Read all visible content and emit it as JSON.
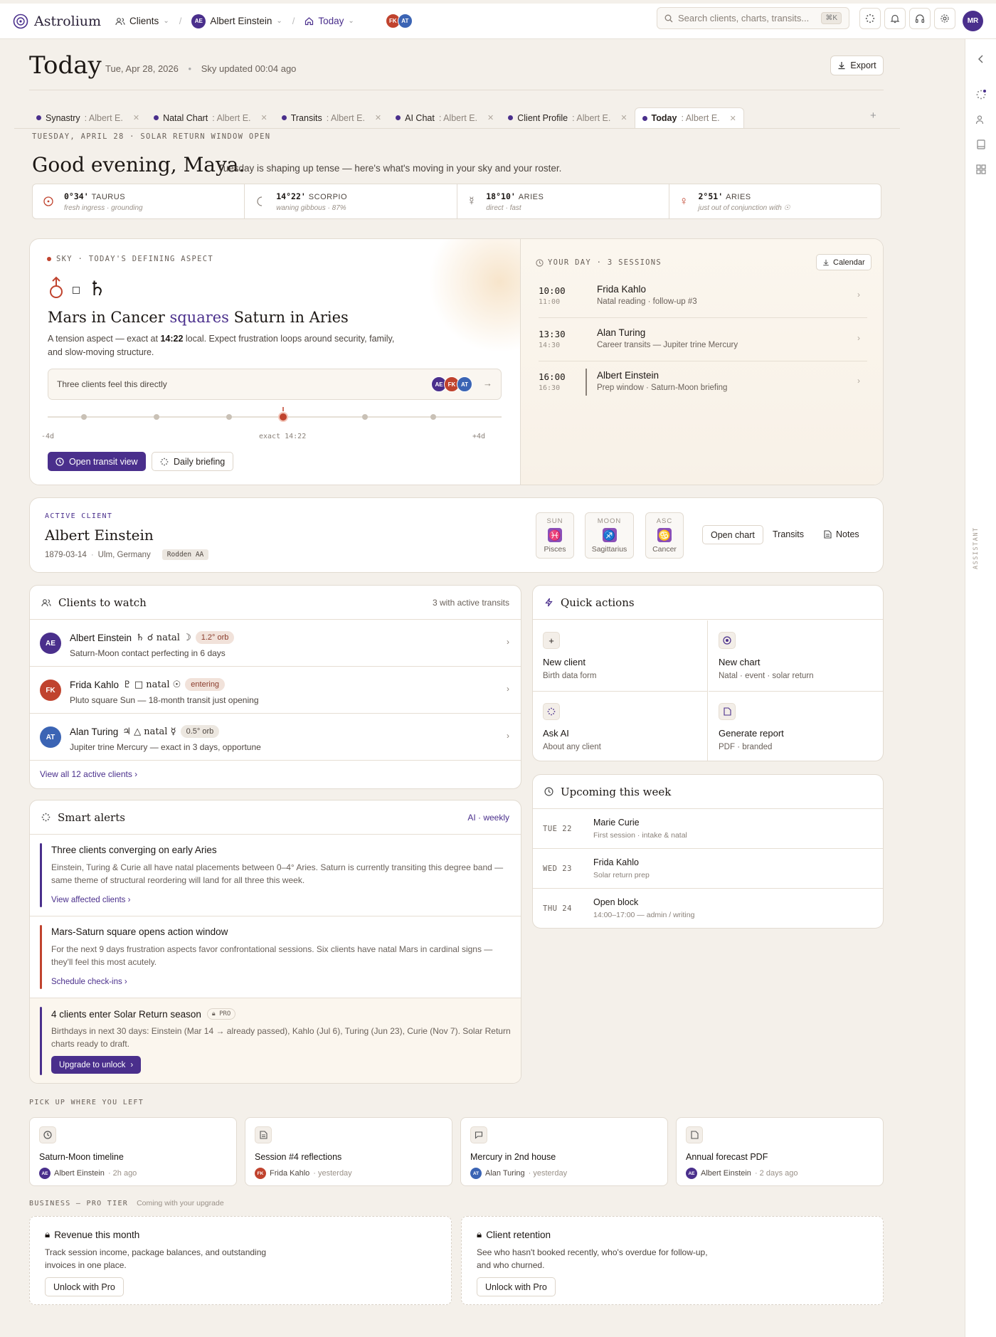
{
  "app": {
    "name": "Astrolium",
    "user_initials": "MR"
  },
  "nav": {
    "clients": "Clients",
    "client": "Albert Einstein",
    "client_initials": "AE",
    "today": "Today",
    "avatars": [
      "FK",
      "AT"
    ]
  },
  "search": {
    "placeholder": "Search clients, charts, transits...",
    "shortcut": "⌘K"
  },
  "colors": {
    "accent": "#4a2f8c",
    "ae": "#4a2f8c",
    "fk": "#c0432e",
    "at": "#3b64b4",
    "ae_bar": "#4a2f8c",
    "alert_red": "#c0432e"
  },
  "header": {
    "title": "Today",
    "date": "Tue, Apr 28, 2026",
    "sky": "Sky updated 00:04 ago",
    "export": "Export"
  },
  "tabs": [
    {
      "label": "Synastry",
      "sub": "Albert E."
    },
    {
      "label": "Natal Chart",
      "sub": "Albert E."
    },
    {
      "label": "Transits",
      "sub": "Albert E."
    },
    {
      "label": "AI Chat",
      "sub": "Albert E."
    },
    {
      "label": "Client Profile",
      "sub": "Albert E."
    },
    {
      "label": "Today",
      "sub": "Albert E."
    }
  ],
  "date_strip": "TUESDAY, APRIL 28 · SOLAR RETURN WINDOW OPEN",
  "greeting": {
    "title": "Good evening, Maya.",
    "sub": "Tuesday is shaping up tense — here's what's moving in your sky and your roster."
  },
  "planets": [
    {
      "icon": "sun-icon",
      "deg": "0°34'",
      "sign": "TAURUS",
      "note": "fresh ingress · grounding"
    },
    {
      "icon": "moon-icon",
      "deg": "14°22'",
      "sign": "SCORPIO",
      "note": "waning gibbous · 87%"
    },
    {
      "icon": "mercury-icon",
      "deg": "18°10'",
      "sign": "ARIES",
      "note": "direct · fast"
    },
    {
      "icon": "venus-icon",
      "deg": "2°51'",
      "sign": "ARIES",
      "note": "just out of conjunction with ☉"
    }
  ],
  "aspect": {
    "label": "SKY · TODAY'S DEFINING ASPECT",
    "title_a": "Mars in Cancer ",
    "title_b": "squares",
    "title_c": " Saturn in Aries",
    "desc_a": "A tension aspect — exact at ",
    "desc_time": "14:22",
    "desc_b": " local. Expect frustration loops around security, family, and slow-moving structure.",
    "clients_note": "Three clients feel this directly",
    "timeline_left": "-4d",
    "timeline_mid": "exact 14:22",
    "timeline_right": "+4d",
    "open_btn": "Open transit view",
    "brief_btn": "Daily briefing"
  },
  "your_day": {
    "label": "YOUR DAY · 3 SESSIONS",
    "calendar": "Calendar",
    "sessions": [
      {
        "start": "10:00",
        "end": "11:00",
        "name": "Frida Kahlo",
        "desc": "Natal reading · follow-up #3"
      },
      {
        "start": "13:30",
        "end": "14:30",
        "name": "Alan Turing",
        "desc": "Career transits — Jupiter trine Mercury"
      },
      {
        "start": "16:00",
        "end": "16:30",
        "name": "Albert Einstein",
        "desc": "Prep window · Saturn-Moon briefing"
      }
    ]
  },
  "active_client": {
    "label": "ACTIVE CLIENT",
    "name": "Albert Einstein",
    "birth": "1879-03-14",
    "place": "Ulm, Germany",
    "rating": "Rodden AA",
    "signs": [
      {
        "k": "SUN",
        "glyph": "♓",
        "v": "Pisces"
      },
      {
        "k": "MOON",
        "glyph": "♐",
        "v": "Sagittarius"
      },
      {
        "k": "ASC",
        "glyph": "♋",
        "v": "Cancer"
      }
    ],
    "open_chart": "Open chart",
    "transits": "Transits",
    "notes": "Notes"
  },
  "watch": {
    "title": "Clients to watch",
    "count": "3 with active transits",
    "rows": [
      {
        "initials": "AE",
        "name": "Albert Einstein",
        "glyph": "♄ ☌ natal ☽",
        "pill": "1.2° orb",
        "desc": "Saturn-Moon contact perfecting in 6 days"
      },
      {
        "initials": "FK",
        "name": "Frida Kahlo",
        "glyph": "♇ □ natal ☉",
        "pill": "entering",
        "desc": "Pluto square Sun — 18-month transit just opening"
      },
      {
        "initials": "AT",
        "name": "Alan Turing",
        "glyph": "♃ △ natal ☿",
        "pill": "0.5° orb",
        "desc": "Jupiter trine Mercury — exact in 3 days, opportune"
      }
    ],
    "view_all": "View all 12 active clients"
  },
  "quick": {
    "title": "Quick actions",
    "items": [
      {
        "name": "New client",
        "desc": "Birth data form"
      },
      {
        "name": "New chart",
        "desc": "Natal · event · solar return"
      },
      {
        "name": "Ask AI",
        "desc": "About any client"
      },
      {
        "name": "Generate report",
        "desc": "PDF · branded"
      }
    ]
  },
  "upcoming": {
    "title": "Upcoming this week",
    "items": [
      {
        "day": "TUE 22",
        "name": "Marie Curie",
        "desc": "First session · intake & natal"
      },
      {
        "day": "WED 23",
        "name": "Frida Kahlo",
        "desc": "Solar return prep"
      },
      {
        "day": "THU 24",
        "name": "Open block",
        "desc": "14:00–17:00 — admin / writing"
      }
    ]
  },
  "alerts": {
    "title": "Smart alerts",
    "tag": "AI · weekly",
    "items": [
      {
        "title": "Three clients converging on early Aries",
        "body": "Einstein, Turing & Curie all have natal placements between 0–4° Aries. Saturn is currently transiting this degree band — same theme of structural reordering will land for all three this week.",
        "link": "View affected clients"
      },
      {
        "title": "Mars-Saturn square opens action window",
        "body": "For the next 9 days frustration aspects favor confrontational sessions. Six clients have natal Mars in cardinal signs — they'll feel this most acutely.",
        "link": "Schedule check-ins"
      },
      {
        "title": "4 clients enter Solar Return season",
        "badge": "PRO",
        "body": "Birthdays in next 30 days: Einstein (Mar 14 → already passed), Kahlo (Jul 6), Turing (Jun 23), Curie (Nov 7). Solar Return charts ready to draft.",
        "link": "Upgrade to unlock"
      }
    ]
  },
  "pickup": {
    "label": "PICK UP WHERE YOU LEFT",
    "items": [
      {
        "name": "Saturn-Moon timeline",
        "initials": "AE",
        "who": "Albert Einstein",
        "when": "· 2h ago"
      },
      {
        "name": "Session #4 reflections",
        "initials": "FK",
        "who": "Frida Kahlo",
        "when": "· yesterday"
      },
      {
        "name": "Mercury in 2nd house",
        "initials": "AT",
        "who": "Alan Turing",
        "when": "· yesterday"
      },
      {
        "name": "Annual forecast PDF",
        "initials": "AE",
        "who": "Albert Einstein",
        "when": "· 2 days ago"
      }
    ]
  },
  "business": {
    "label": "BUSINESS — PRO TIER",
    "sub": "Coming with your upgrade",
    "items": [
      {
        "title": "Revenue this month",
        "desc": "Track session income, package balances, and outstanding invoices in one place.",
        "btn": "Unlock with Pro"
      },
      {
        "title": "Client retention",
        "desc": "See who hasn't booked recently, who's overdue for follow-up, and who churned.",
        "btn": "Unlock with Pro"
      }
    ]
  },
  "rail": {
    "assistant": "ASSISTANT"
  }
}
